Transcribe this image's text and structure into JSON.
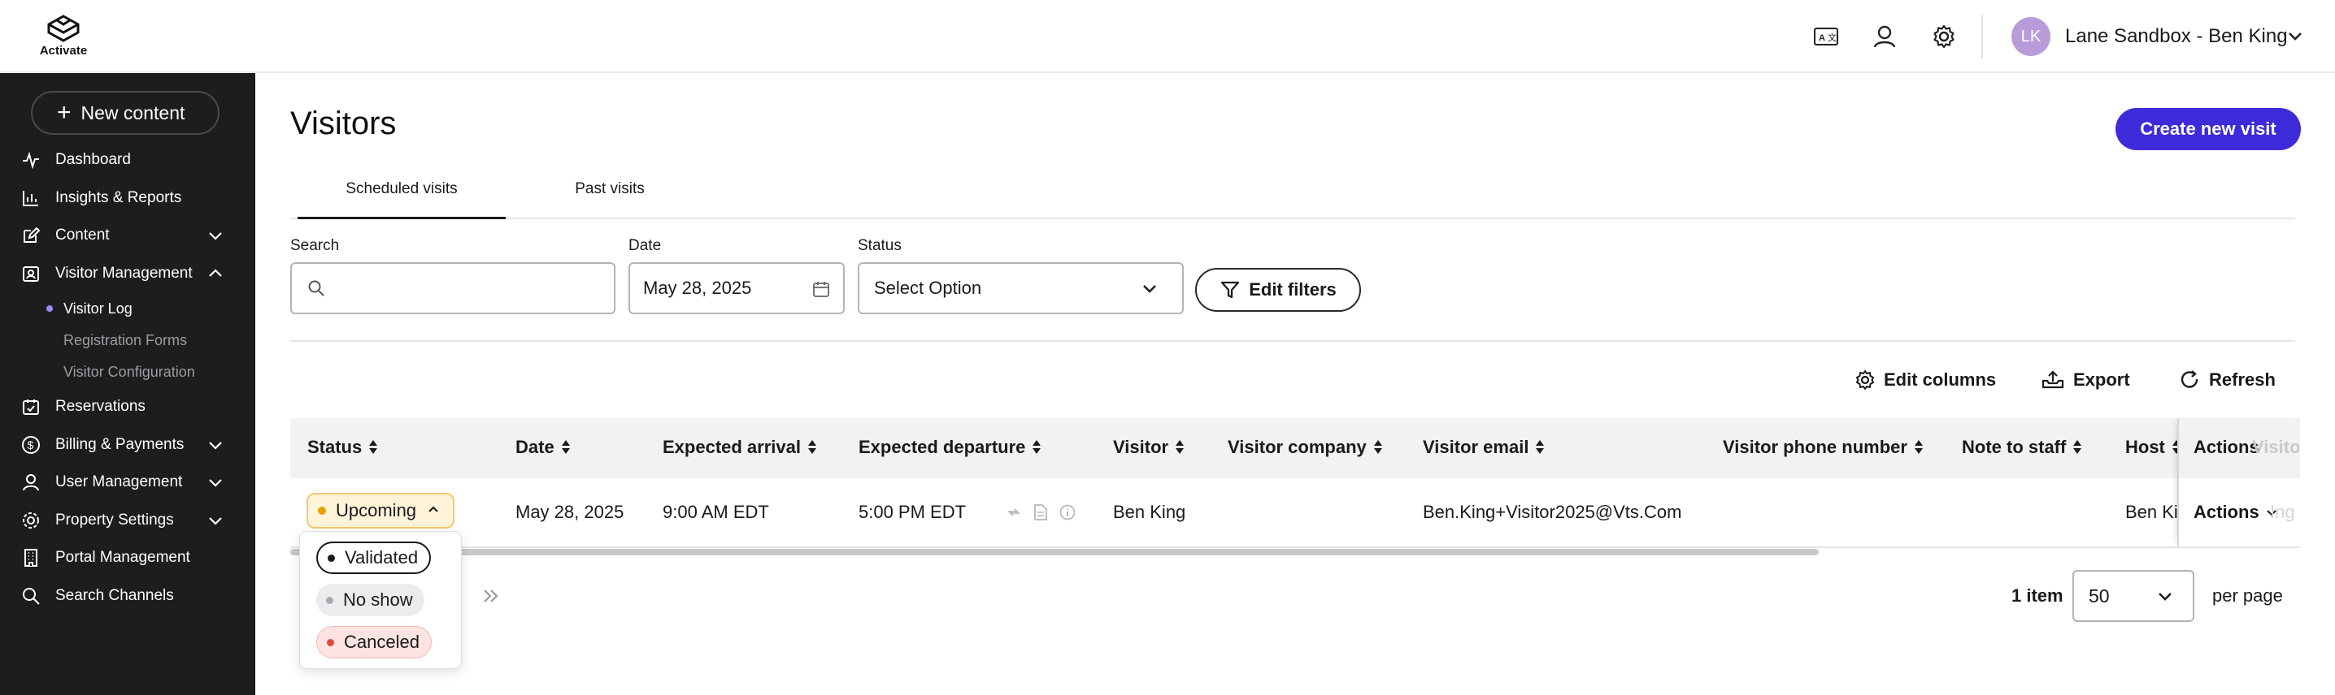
{
  "app": {
    "logo_text": "Activate"
  },
  "header": {
    "avatar_initials": "LK",
    "account_name": "Lane Sandbox - Ben King"
  },
  "sidebar": {
    "new_content": "New content",
    "items": [
      {
        "label": "Dashboard",
        "icon": "pulse-icon"
      },
      {
        "label": "Insights & Reports",
        "icon": "bar-chart-icon"
      },
      {
        "label": "Content",
        "icon": "edit-icon",
        "expandable": true
      },
      {
        "label": "Visitor Management",
        "icon": "badge-icon",
        "expanded": true
      },
      {
        "label": "Reservations",
        "icon": "calendar-check-icon"
      },
      {
        "label": "Billing & Payments",
        "icon": "dollar-icon",
        "expandable": true
      },
      {
        "label": "User Management",
        "icon": "user-icon",
        "expandable": true
      },
      {
        "label": "Property Settings",
        "icon": "gear-icon",
        "expandable": true
      },
      {
        "label": "Portal Management",
        "icon": "building-icon"
      },
      {
        "label": "Search Channels",
        "icon": "search-icon"
      }
    ],
    "sub_items": [
      {
        "label": "Visitor Log",
        "active": true
      },
      {
        "label": "Registration Forms"
      },
      {
        "label": "Visitor Configuration"
      }
    ]
  },
  "page": {
    "title": "Visitors",
    "create_button": "Create new visit",
    "tabs": [
      {
        "label": "Scheduled visits",
        "active": true
      },
      {
        "label": "Past visits"
      }
    ]
  },
  "filters": {
    "search_label": "Search",
    "search_value": "",
    "date_label": "Date",
    "date_value": "May 28, 2025",
    "status_label": "Status",
    "status_value": "Select Option",
    "edit_filters": "Edit filters"
  },
  "toolbar": {
    "edit_columns": "Edit columns",
    "export": "Export",
    "refresh": "Refresh"
  },
  "table": {
    "columns": [
      "Status",
      "Date",
      "Expected arrival",
      "Expected departure",
      "Visitor",
      "Visitor company",
      "Visitor email",
      "Visitor phone number",
      "Note to staff",
      "Host",
      "Actions"
    ],
    "ghost_header": "Visitor Co",
    "ghost_cell": "Ing",
    "rows": [
      {
        "status": "Upcoming",
        "date": "May 28, 2025",
        "arrival": "9:00 AM EDT",
        "departure": "5:00 PM EDT",
        "visitor": "Ben King",
        "company": "",
        "email": "Ben.King+Visitor2025@Vts.Com",
        "phone": "",
        "note": "",
        "host": "Ben Ki",
        "actions": "Actions"
      }
    ]
  },
  "status_dropdown": {
    "options": [
      {
        "label": "Validated",
        "color": "#1a1a1a",
        "bg": "#ffffff",
        "border": "#1a1a1a"
      },
      {
        "label": "No show",
        "color": "#9a9aa2",
        "bg": "#ececef",
        "border": "#ececef"
      },
      {
        "label": "Canceled",
        "color": "#e0483e",
        "bg": "#fde3e1",
        "border": "#f5b8b3"
      }
    ]
  },
  "pagination": {
    "items_count": "1 item",
    "per_page_value": "50",
    "per_page_label": "per page"
  },
  "colors": {
    "accent": "#3d2bd9",
    "sidebar_bg": "#1d1d1f",
    "upcoming": "#e8a200"
  }
}
